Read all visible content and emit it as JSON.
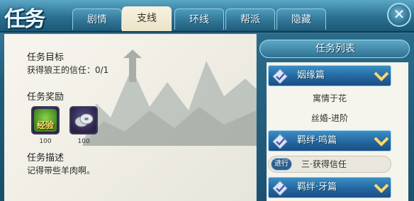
{
  "header": {
    "title": "任务",
    "tabs": [
      {
        "label": "剧情"
      },
      {
        "label": "支线"
      },
      {
        "label": "环线"
      },
      {
        "label": "帮派"
      },
      {
        "label": "隐藏"
      }
    ],
    "active_tab": "支线",
    "close_label": "✕"
  },
  "detail": {
    "objective_heading": "任务目标",
    "objective_text": "获得狼王的信任：0/1",
    "rewards_heading": "任务奖励",
    "rewards": [
      {
        "icon": "experience-icon",
        "icon_text": "经验",
        "count": "100"
      },
      {
        "icon": "silver-coin-icon",
        "count": "100"
      }
    ],
    "description_heading": "任务描述",
    "description_text": "记得带些羊肉啊。"
  },
  "task_list": {
    "heading": "任务列表",
    "categories": [
      {
        "label": "姻缘篇",
        "items": [
          "寓情于花",
          "丝婚-进阶"
        ]
      },
      {
        "label": "羁绊·鸣篇",
        "current": {
          "badge": "进行",
          "label": "三·获得信任"
        }
      },
      {
        "label": "羁绊·牙篇"
      }
    ]
  },
  "colors": {
    "accent_blue": "#2466a0",
    "header_teal": "#2b6f90",
    "panel_bg": "#f5f4ed"
  }
}
